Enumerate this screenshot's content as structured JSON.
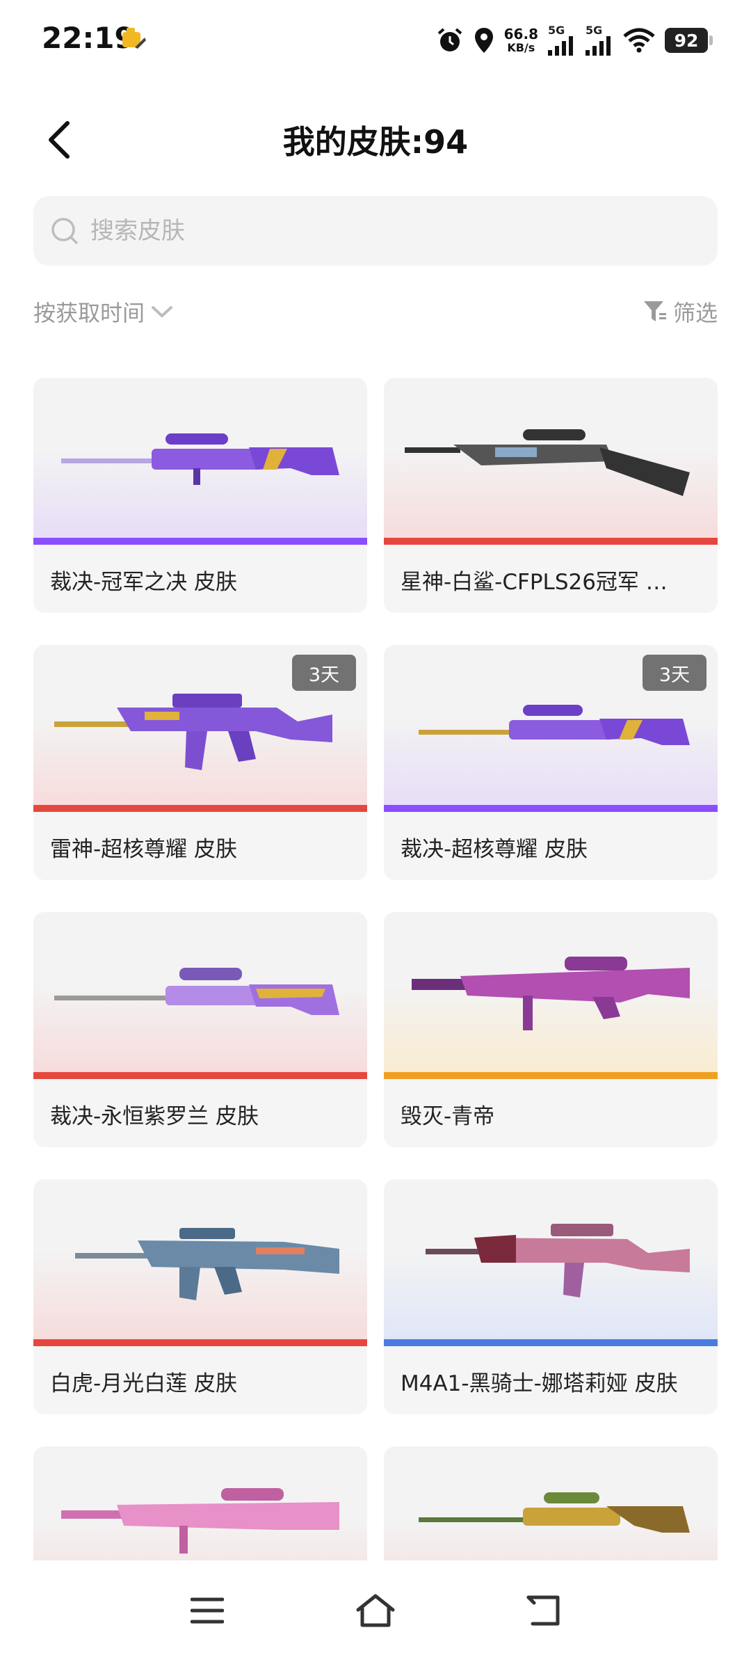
{
  "status_bar": {
    "time": "22:19",
    "net_speed_value": "66.8",
    "net_speed_unit": "KB/s",
    "sim1": "5G",
    "sim2": "5G",
    "battery": "92"
  },
  "header": {
    "title": "我的皮肤:94"
  },
  "search": {
    "placeholder": "搜索皮肤"
  },
  "sort": {
    "label": "按获取时间",
    "filter_label": "筛选"
  },
  "skins": [
    {
      "name": "裁决-冠军之决 皮肤",
      "badge": "",
      "rarity_color": "#8a4dff"
    },
    {
      "name": "星神-白鲨-CFPLS26冠军 …",
      "badge": "",
      "rarity_color": "#e5473d"
    },
    {
      "name": "雷神-超核尊耀 皮肤",
      "badge": "3天",
      "rarity_color": "#e5473d"
    },
    {
      "name": "裁决-超核尊耀 皮肤",
      "badge": "3天",
      "rarity_color": "#8a4dff"
    },
    {
      "name": "裁决-永恒紫罗兰 皮肤",
      "badge": "",
      "rarity_color": "#e5473d"
    },
    {
      "name": "毁灭-青帝",
      "badge": "",
      "rarity_color": "#f0a020"
    },
    {
      "name": "白虎-月光白莲 皮肤",
      "badge": "",
      "rarity_color": "#e5473d"
    },
    {
      "name": "M4A1-黑骑士-娜塔莉娅 皮肤",
      "badge": "",
      "rarity_color": "#4a7be0"
    },
    {
      "name": "",
      "badge": "",
      "rarity_color": "#e5473d"
    },
    {
      "name": "",
      "badge": "",
      "rarity_color": "#e5473d"
    }
  ],
  "colors": {
    "accent_purple": "#8a4dff",
    "accent_red": "#e5473d",
    "accent_gold": "#f0a020",
    "accent_blue": "#4a7be0"
  }
}
